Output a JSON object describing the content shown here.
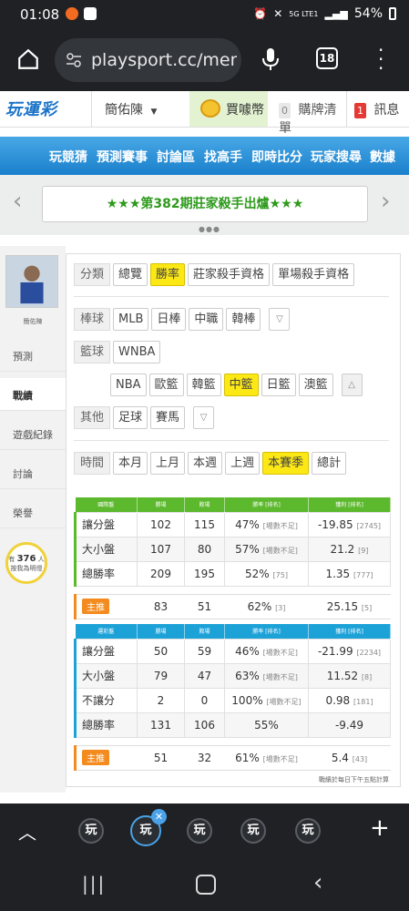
{
  "status_bar": {
    "time": "01:08",
    "battery": "54%",
    "network": "5G LTE1"
  },
  "browser": {
    "url": "playsport.cc/men",
    "tab_count": "18"
  },
  "site_header": {
    "logo": "玩運彩",
    "user_name": "簡佑陳",
    "coin_label": "買噱幣",
    "cart_count": "0",
    "cart_label": "購牌清單",
    "msg_count": "1",
    "msg_label": "訊息"
  },
  "nav": {
    "items": [
      "玩競猜",
      "預測賽事",
      "討論區",
      "找高手",
      "即時比分",
      "玩家搜尋",
      "數據"
    ]
  },
  "banner": {
    "text": "★★★第382期莊家殺手出爐★★★"
  },
  "sidebar": {
    "username": "簡佑陳",
    "items": [
      {
        "label": "預測"
      },
      {
        "label": "戰績"
      },
      {
        "label": "遊戲紀錄"
      },
      {
        "label": "討論"
      },
      {
        "label": "榮譽"
      }
    ],
    "bulb_prefix": "有",
    "bulb_count": "376",
    "bulb_suffix": "人",
    "bulb_text": "按我為明燈"
  },
  "filters": {
    "category_label": "分類",
    "category_options": [
      "總覽",
      "勝率",
      "莊家殺手資格",
      "單場殺手資格"
    ],
    "baseball_label": "棒球",
    "baseball_options": [
      "MLB",
      "日棒",
      "中職",
      "韓棒"
    ],
    "basketball_label": "籃球",
    "basketball_options_row1": [
      "WNBA"
    ],
    "basketball_options_row2": [
      "NBA",
      "歐籃",
      "韓籃",
      "中籃",
      "日籃",
      "澳籃"
    ],
    "other_label": "其他",
    "other_options": [
      "足球",
      "賽馬"
    ],
    "time_label": "時間",
    "time_options": [
      "本月",
      "上月",
      "本週",
      "上週",
      "本賽季",
      "總計"
    ]
  },
  "table1": {
    "headers": [
      "國際盤",
      "勝場",
      "敗場",
      "勝率 [排名]",
      "獲利 [排名]"
    ],
    "header_color": "#5cb82c",
    "rows": [
      {
        "name": "讓分盤",
        "win": "102",
        "lose": "115",
        "rate": "47%",
        "rate_rank": "[場數不足]",
        "profit": "-19.85",
        "profit_rank": "[2745]"
      },
      {
        "name": "大小盤",
        "win": "107",
        "lose": "80",
        "rate": "57%",
        "rate_rank": "[場數不足]",
        "profit": "21.2",
        "profit_rank": "[9]"
      },
      {
        "name": "總勝率",
        "win": "209",
        "lose": "195",
        "rate": "52%",
        "rate_rank": "[75]",
        "profit": "1.35",
        "profit_rank": "[777]"
      }
    ],
    "main_pick": {
      "label": "主推",
      "win": "83",
      "lose": "51",
      "rate": "62%",
      "rate_rank": "[3]",
      "profit": "25.15",
      "profit_rank": "[5]"
    }
  },
  "table2": {
    "headers": [
      "運彩盤",
      "勝場",
      "敗場",
      "勝率 [排名]",
      "獲利 [排名]"
    ],
    "header_color": "#1da2d8",
    "rows": [
      {
        "name": "讓分盤",
        "win": "50",
        "lose": "59",
        "rate": "46%",
        "rate_rank": "[場數不足]",
        "profit": "-21.99",
        "profit_rank": "[2234]"
      },
      {
        "name": "大小盤",
        "win": "79",
        "lose": "47",
        "rate": "63%",
        "rate_rank": "[場數不足]",
        "profit": "11.52",
        "profit_rank": "[8]"
      },
      {
        "name": "不讓分",
        "win": "2",
        "lose": "0",
        "rate": "100%",
        "rate_rank": "[場數不足]",
        "profit": "0.98",
        "profit_rank": "[181]"
      },
      {
        "name": "總勝率",
        "win": "131",
        "lose": "106",
        "rate": "55%",
        "rate_rank": "",
        "profit": "-9.49",
        "profit_rank": ""
      }
    ],
    "main_pick": {
      "label": "主推",
      "win": "51",
      "lose": "32",
      "rate": "61%",
      "rate_rank": "[場數不足]",
      "profit": "5.4",
      "profit_rank": "[43]"
    }
  },
  "footnote": "戰績於每日下午五點計算",
  "tab_strip": {
    "icon_glyph": "玩"
  }
}
